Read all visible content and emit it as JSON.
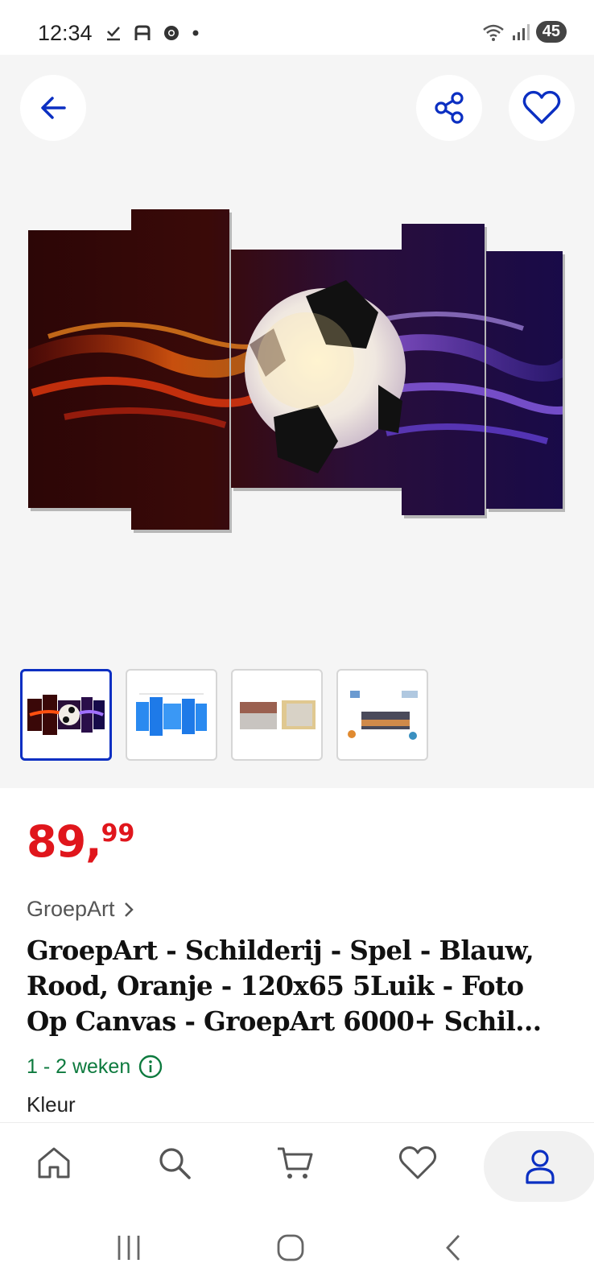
{
  "status_bar": {
    "time": "12:34",
    "battery": "45",
    "icons_left": [
      "download-done-icon",
      "a-icon",
      "chrome-icon",
      "dot-icon"
    ],
    "icons_right": [
      "wifi-icon",
      "signal-icon"
    ]
  },
  "hero": {
    "back_icon": "arrow-left-icon",
    "share_icon": "share-icon",
    "favorite_icon": "heart-icon",
    "thumbnails": [
      {
        "name": "thumb-football-canvas",
        "active": true
      },
      {
        "name": "thumb-dimensions",
        "active": false
      },
      {
        "name": "thumb-canvas-detail",
        "active": false
      },
      {
        "name": "thumb-room-example",
        "active": false
      }
    ]
  },
  "product": {
    "price_main": "89,",
    "price_cents": "99",
    "seller": "GroepArt",
    "title": "GroepArt - Schilderij - Spel - Blauw, Rood, Oranje - 120x65 5Luik - Foto Op Canvas - GroepArt 6000+ Schil...",
    "delivery": "1 - 2 weken",
    "color_label": "Kleur"
  },
  "bottom_nav": {
    "items": [
      "home-icon",
      "search-icon",
      "cart-icon",
      "heart-icon",
      "account-icon"
    ],
    "active": "account-icon"
  },
  "colors": {
    "accent_blue": "#0b2fc2",
    "price_red": "#e0161c",
    "delivery_green": "#0d7a3e"
  }
}
